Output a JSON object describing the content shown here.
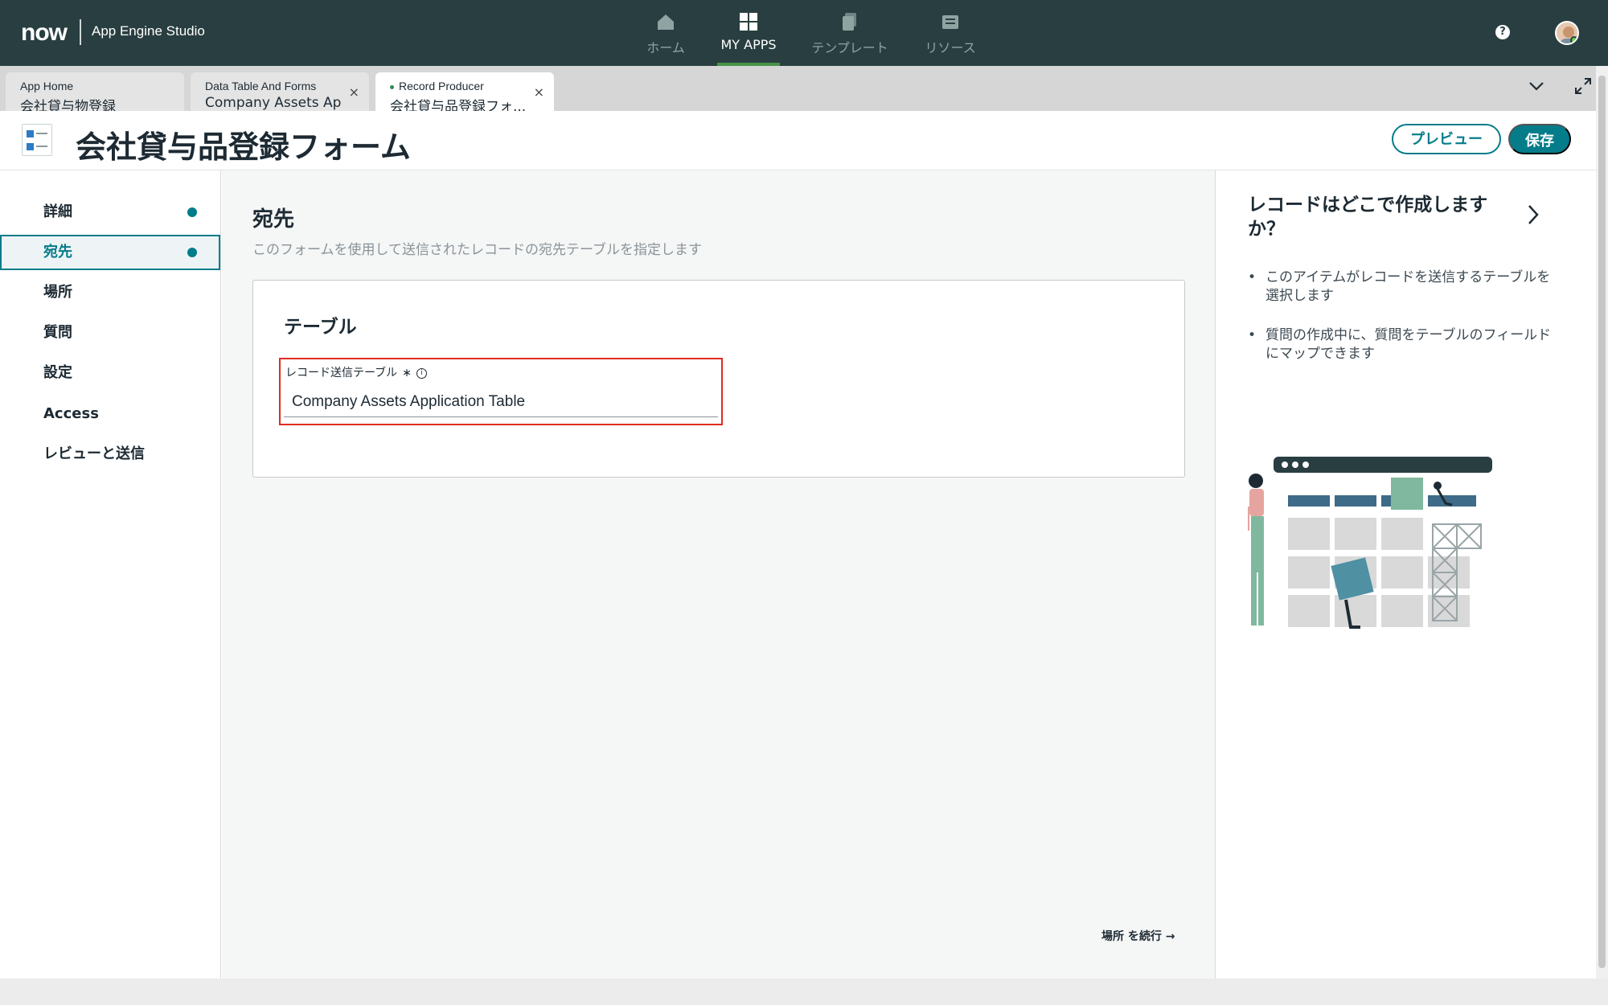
{
  "topbar": {
    "logo": "now",
    "app_name": "App Engine Studio",
    "nav": [
      {
        "label": "ホーム",
        "icon": "home-icon",
        "active": false
      },
      {
        "label": "MY APPS",
        "icon": "grid-icon",
        "active": true
      },
      {
        "label": "テンプレート",
        "icon": "templates-icon",
        "active": false
      },
      {
        "label": "リソース",
        "icon": "resources-icon",
        "active": false
      }
    ],
    "help_icon": "?"
  },
  "tabs": [
    {
      "line1": "App Home",
      "line2": "会社貸与物登録",
      "closable": false,
      "active": false
    },
    {
      "line1": "Data Table And Forms",
      "line2": "Company Assets Ap...",
      "closable": true,
      "active": false
    },
    {
      "line1": "Record Producer",
      "line2": "会社貸与品登録フォ...",
      "closable": true,
      "active": true
    }
  ],
  "tab_close_glyph": "×",
  "header": {
    "title": "会社貸与品登録フォーム",
    "preview_label": "プレビュー",
    "save_label": "保存"
  },
  "steps": [
    {
      "label": "詳細",
      "dot": true,
      "active": false
    },
    {
      "label": "宛先",
      "dot": true,
      "active": true
    },
    {
      "label": "場所",
      "dot": false,
      "active": false
    },
    {
      "label": "質問",
      "dot": false,
      "active": false
    },
    {
      "label": "設定",
      "dot": false,
      "active": false
    },
    {
      "label": "Access",
      "dot": false,
      "active": false
    },
    {
      "label": "レビューと送信",
      "dot": false,
      "active": false
    }
  ],
  "main": {
    "title": "宛先",
    "subtitle": "このフォームを使用して送信されたレコードの宛先テーブルを指定します",
    "card_title": "テーブル",
    "field_label": "レコード送信テーブル",
    "field_required": "∗",
    "field_value": "Company Assets Application Table",
    "continue_label": "場所 を続行 →"
  },
  "aside": {
    "title": "レコードはどこで作成しますか？",
    "bullets": [
      "このアイテムがレコードを送信するテーブルを選択します",
      "質問の作成中に、質問をテーブルのフィールドにマップできます"
    ]
  },
  "colors": {
    "topbar": "#293e40",
    "accent": "#047c8a",
    "highlight_border": "#e02b20"
  }
}
